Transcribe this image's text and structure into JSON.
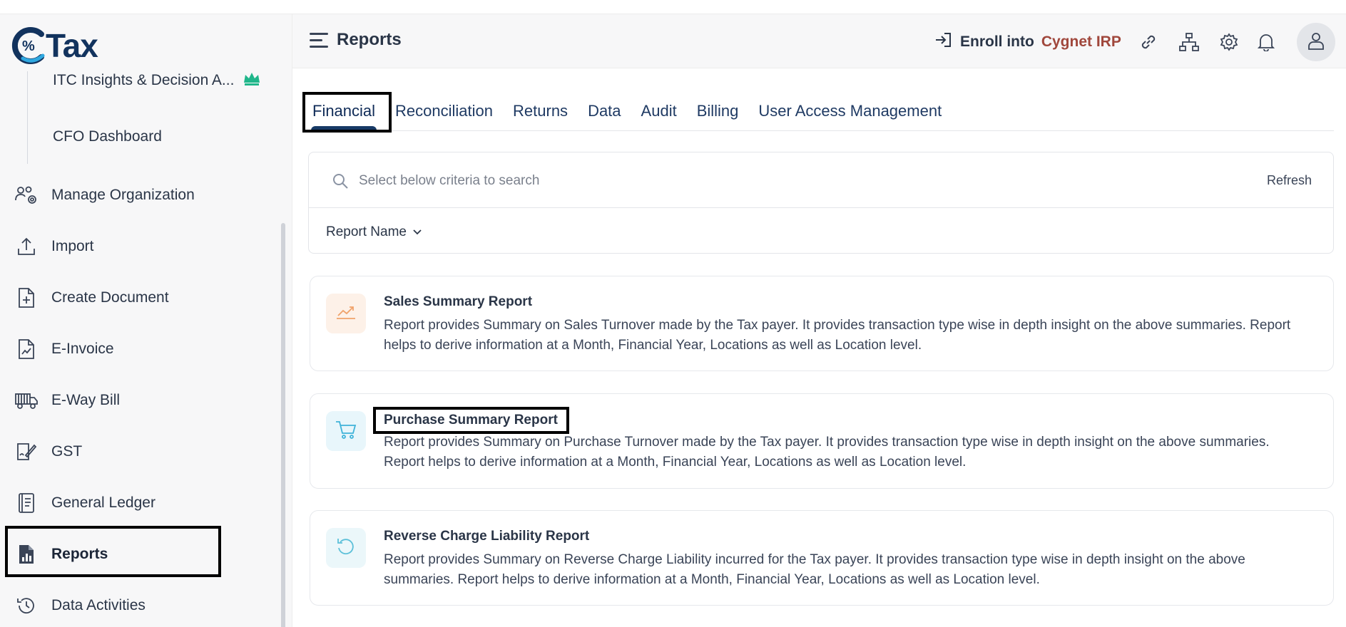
{
  "logo": {
    "text": "Tax"
  },
  "sidebar": {
    "sub_items": [
      {
        "label": "ITC Insights & Decision A..."
      },
      {
        "label": "CFO Dashboard"
      }
    ],
    "items": [
      {
        "label": "Manage Organization",
        "icon": "organization-gear-icon"
      },
      {
        "label": "Import",
        "icon": "upload-icon"
      },
      {
        "label": "Create Document",
        "icon": "document-plus-icon"
      },
      {
        "label": "E-Invoice",
        "icon": "invoice-icon"
      },
      {
        "label": "E-Way Bill",
        "icon": "truck-icon"
      },
      {
        "label": "GST",
        "icon": "signature-document-icon"
      },
      {
        "label": "General Ledger",
        "icon": "ledger-book-icon"
      },
      {
        "label": "Reports",
        "icon": "report-chart-icon",
        "active": true
      },
      {
        "label": "Data Activities",
        "icon": "history-icon"
      }
    ]
  },
  "header": {
    "title": "Reports",
    "enroll_prefix": "Enroll into",
    "enroll_brand": "Cygnet IRP",
    "icons": [
      "link-icon",
      "sitemap-icon",
      "settings-icon",
      "bell-icon",
      "user-icon"
    ]
  },
  "tabs": [
    {
      "label": "Financial",
      "active": true
    },
    {
      "label": "Reconciliation"
    },
    {
      "label": "Returns"
    },
    {
      "label": "Data"
    },
    {
      "label": "Audit"
    },
    {
      "label": "Billing"
    },
    {
      "label": "User Access Management"
    }
  ],
  "search": {
    "placeholder": "Select below criteria to search",
    "refresh_label": "Refresh",
    "filter_label": "Report Name"
  },
  "reports": [
    {
      "title": "Sales Summary Report",
      "description": "Report provides Summary on Sales Turnover made by the Tax payer. It provides transaction type wise in depth insight on the above summaries. Report helps to derive information at a Month, Financial Year, Locations as well as Location level.",
      "icon": "trend-chart-icon",
      "icon_color": "#f0a36b",
      "icon_bg": "#fdf1e8"
    },
    {
      "title": "Purchase Summary Report",
      "description": "Report provides Summary on Purchase Turnover made by the Tax payer. It provides transaction type wise in depth insight on the above summaries. Report helps to derive information at a Month, Financial Year, Locations as well as Location level.",
      "icon": "cart-icon",
      "icon_color": "#3fb3d9",
      "icon_bg": "#e8f6fb"
    },
    {
      "title": "Reverse Charge Liability Report",
      "description": "Report provides Summary on Reverse Charge Liability incurred for the Tax payer. It provides transaction type wise in depth insight on the above summaries. Report helps to derive information at a Month, Financial Year, Locations as well as Location level.",
      "icon": "reverse-arrow-icon",
      "icon_color": "#5cc0d9",
      "icon_bg": "#ebf7fa"
    }
  ]
}
